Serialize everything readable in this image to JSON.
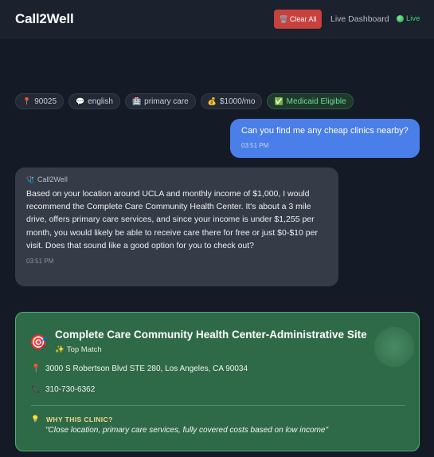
{
  "header": {
    "logo": "Call2Well",
    "clear_label": "Clear All",
    "dashboard_label": "Live Dashboard",
    "live_label": "Live"
  },
  "chips": [
    {
      "icon": "📍",
      "label": "90025"
    },
    {
      "icon": "💬",
      "label": "english"
    },
    {
      "icon": "🏥",
      "label": "primary care"
    },
    {
      "icon": "💰",
      "label": "$1000/mo"
    },
    {
      "icon": "✅",
      "label": "Medicaid Eligible"
    }
  ],
  "messages": {
    "user": {
      "text": "Can you find me any cheap clinics nearby?",
      "time": "03:51 PM"
    },
    "bot": {
      "name": "Call2Well",
      "text": "Based on your location around UCLA and monthly income of $1,000, I would recommend the Complete Care Community Health Center. It's about a 3 mile drive, offers primary care services, and since your income is under $1,255 per month, you would likely be able to receive care there for free or just $0-$10 per visit. Does that sound like a good option for you to check out?",
      "time": "03:51 PM"
    }
  },
  "clinic": {
    "name": "Complete Care Community Health Center-Administrative Site",
    "badge": "Top Match",
    "address": "3000 S Robertson Blvd STE 280, Los Angeles, CA 90034",
    "phone": "310-730-6362",
    "why_heading": "WHY THIS CLINIC?",
    "why_text": "\"Close location, primary care services, fully covered costs based on low income\""
  },
  "colors": {
    "background": "#141a26",
    "accent_blue": "#4a7ee8",
    "clear_red": "#c8413c",
    "live_green": "#3ecf6a",
    "card_green": "#2f6a48"
  }
}
